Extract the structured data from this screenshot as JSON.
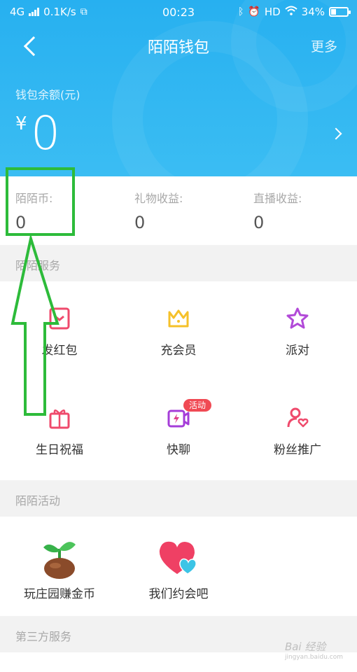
{
  "status_bar": {
    "network": "4G",
    "speed": "0.1K/s",
    "time": "00:23",
    "hd": "HD",
    "battery_percent": "34%",
    "battery_level": 0.34,
    "icons": [
      "bluetooth-icon",
      "alarm-icon",
      "wifi-icon",
      "battery-icon"
    ]
  },
  "header": {
    "title": "陌陌钱包",
    "more_label": "更多",
    "back_icon": "back-arrow-icon"
  },
  "wallet": {
    "balance_label": "钱包余额(元)",
    "currency_symbol": "¥",
    "balance": "0"
  },
  "stats": [
    {
      "label": "陌陌币:",
      "value": "0"
    },
    {
      "label": "礼物收益:",
      "value": "0"
    },
    {
      "label": "直播收益:",
      "value": "0"
    }
  ],
  "services": {
    "title": "陌陌服务",
    "items": [
      {
        "label": "发红包",
        "icon": "red-envelope-icon"
      },
      {
        "label": "充会员",
        "icon": "crown-icon"
      },
      {
        "label": "派对",
        "icon": "star-icon"
      },
      {
        "label": "生日祝福",
        "icon": "gift-icon"
      },
      {
        "label": "快聊",
        "icon": "video-chat-icon",
        "badge": "活动"
      },
      {
        "label": "粉丝推广",
        "icon": "fan-promote-icon"
      }
    ]
  },
  "activities": {
    "title": "陌陌活动",
    "items": [
      {
        "label": "玩庄园赚金币",
        "icon": "sprout-icon"
      },
      {
        "label": "我们约会吧",
        "icon": "hearts-icon"
      }
    ]
  },
  "third_party": {
    "title": "第三方服务"
  },
  "watermark": {
    "text": "Bai 经验",
    "sub": "jingyan.baidu.com"
  },
  "colors": {
    "header_blue": "#2fb4f1",
    "annotation_green": "#2dbb3a",
    "badge_red": "#f04a54"
  }
}
